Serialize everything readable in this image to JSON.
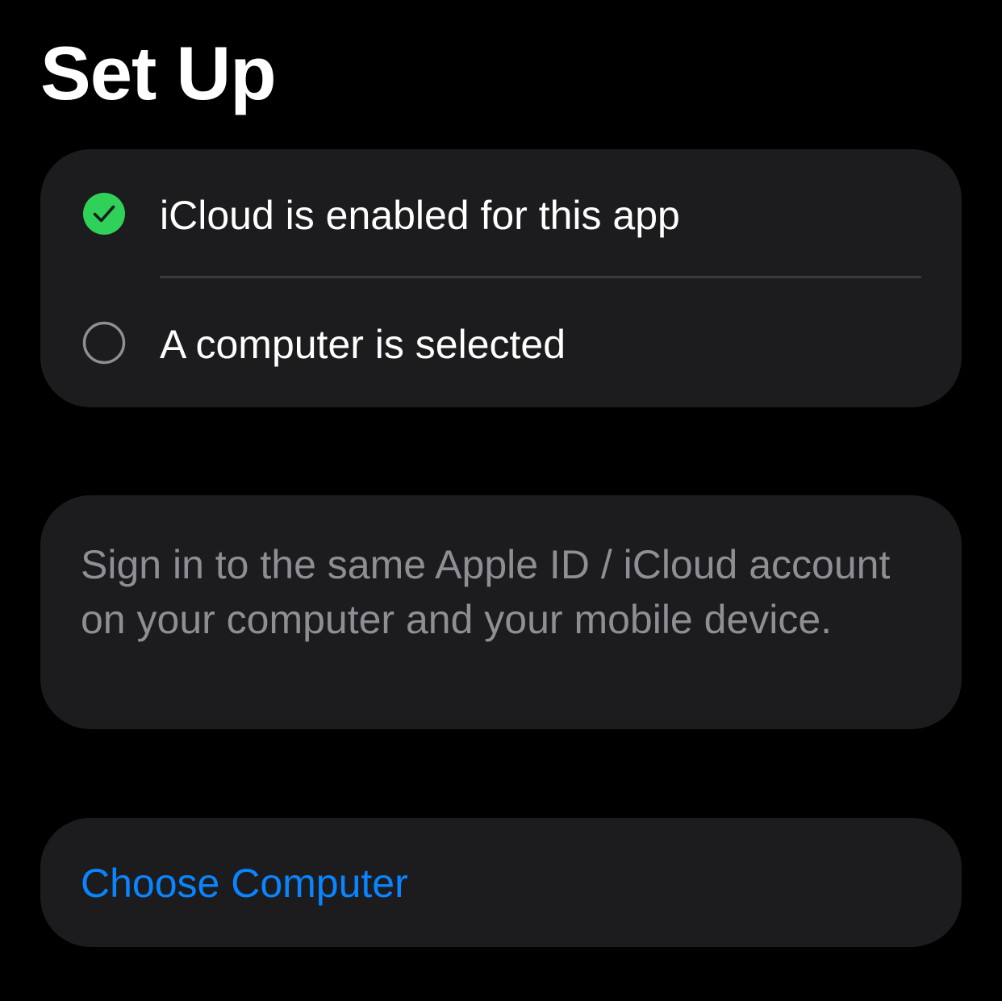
{
  "header": {
    "title": "Set Up"
  },
  "status": {
    "items": [
      {
        "label": "iCloud is enabled for this app",
        "state": "complete",
        "icon": "checkmark-circle-icon",
        "color": "#30d158"
      },
      {
        "label": "A computer is selected",
        "state": "incomplete",
        "icon": "empty-circle-icon",
        "color": "#8e8e93"
      }
    ]
  },
  "info": {
    "text": "Sign in to the same Apple ID / iCloud account on your computer and your mobile device."
  },
  "actions": {
    "choose_computer_label": "Choose Computer",
    "accent_color": "#0a84ff"
  },
  "theme": {
    "background": "#000000",
    "card_background": "#1c1c1e",
    "secondary_text": "#8e8e93"
  }
}
